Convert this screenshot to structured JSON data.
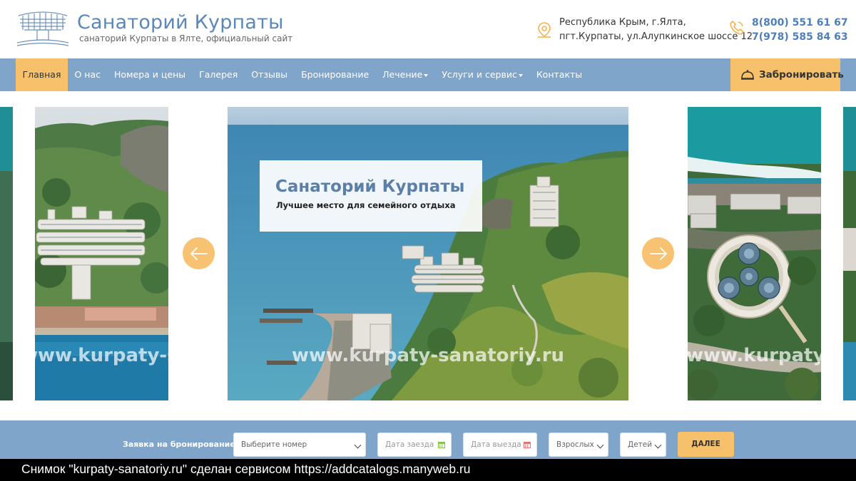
{
  "header": {
    "title": "Санаторий Курпаты",
    "subtitle": "санаторий Курпаты в Ялте, официальный сайт",
    "address_line1": "Республика Крым, г.Ялта,",
    "address_line2": "пгт.Курпаты, ул.Алупкинское шоссе 12",
    "phone1": "8(800) 551 61 67",
    "phone2": "7(978) 585 84 63"
  },
  "nav": {
    "items": [
      {
        "label": "Главная"
      },
      {
        "label": "О нас"
      },
      {
        "label": "Номера и цены"
      },
      {
        "label": "Галерея"
      },
      {
        "label": "Отзывы"
      },
      {
        "label": "Бронирование"
      },
      {
        "label": "Лечение"
      },
      {
        "label": "Услуги и сервис"
      },
      {
        "label": "Контакты"
      }
    ],
    "book_label": "Забронировать"
  },
  "slider": {
    "caption_title": "Санаторий Курпаты",
    "caption_sub": "Лучшее место для семейного отдыха",
    "watermark_center": "www.kurpaty-sanatoriy.ru",
    "watermark_left": "www.kurpaty-s",
    "watermark_right": "www.kurpaty-s"
  },
  "booking": {
    "label": "Заявка на бронирование",
    "room_placeholder": "Выберите номер",
    "checkin_placeholder": "Дата заезда",
    "checkout_placeholder": "Дата выезда",
    "adults_placeholder": "Взрослых",
    "children_placeholder": "Детей",
    "next_label": "ДАЛЕЕ"
  },
  "credit": "Снимок \"kurpaty-sanatoriy.ru\" сделан сервисом https://addcatalogs.manyweb.ru",
  "colors": {
    "accent": "#f6c16a",
    "nav_bg": "#80a5cb",
    "title_blue": "#5b87ba"
  },
  "icons": {
    "logo": "sanatorium-building-logo",
    "address": "map-pin-icon",
    "phone": "phone-icon",
    "book": "bell-icon",
    "prev": "arrow-left-icon",
    "next": "arrow-right-icon",
    "calendar": "calendar-icon"
  }
}
